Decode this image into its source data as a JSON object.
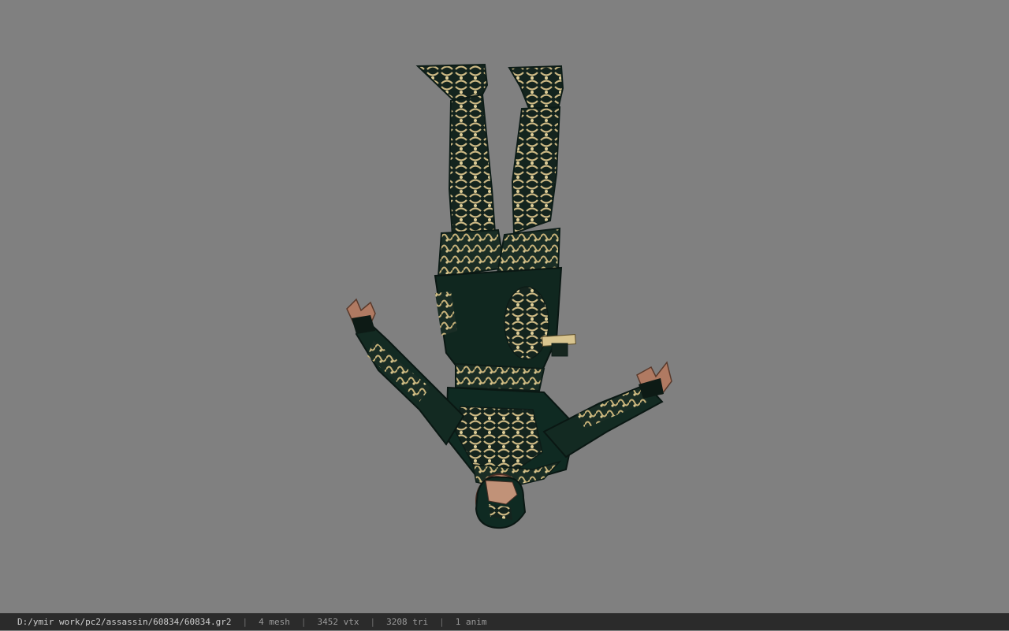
{
  "viewer": {
    "background_color": "#808080"
  },
  "model": {
    "subject": "assassin character model (upside-down)",
    "primary_color": "#0f2a22",
    "trim_color": "#c8b37a",
    "skin_color": "#b07a62"
  },
  "status": {
    "file_path": "D:/ymir work/pc2/assassin/60834/60834.gr2",
    "sep": "|",
    "mesh": "4 mesh",
    "vtx": "3452 vtx",
    "tri": "3208 tri",
    "anim": "1 anim"
  }
}
